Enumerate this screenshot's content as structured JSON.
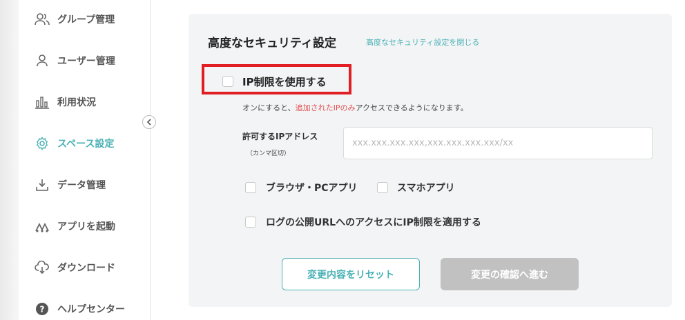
{
  "sidebar": {
    "items": [
      {
        "label": "グループ管理",
        "icon": "group-icon"
      },
      {
        "label": "ユーザー管理",
        "icon": "user-icon"
      },
      {
        "label": "利用状況",
        "icon": "bar-chart-icon"
      },
      {
        "label": "スペース設定",
        "icon": "gear-icon",
        "active": true
      },
      {
        "label": "データ管理",
        "icon": "download-icon"
      },
      {
        "label": "アプリを起動",
        "icon": "apps-icon"
      },
      {
        "label": "ダウンロード",
        "icon": "cloud-download-icon"
      },
      {
        "label": "ヘルプセンター",
        "icon": "help-icon"
      }
    ]
  },
  "panel": {
    "title": "高度なセキュリティ設定",
    "close_link": "高度なセキュリティ設定を閉じる",
    "ip_restriction_label": "IP制限を使用する",
    "description_prefix": "オンにすると、",
    "description_highlight": "追加されたIPのみ",
    "description_suffix": "アクセスできるようになります。",
    "address_label": "許可するIPアドレス",
    "address_sublabel": "（カンマ区切）",
    "address_placeholder": "xxx.xxx.xxx.xxx,xxx.xxx.xxx.xxx/xx",
    "address_value": "",
    "option_browser_pc": "ブラウザ・PCアプリ",
    "option_smartphone": "スマホアプリ",
    "option_log_url": "ログの公開URLへのアクセスにIP制限を適用する",
    "reset_button": "変更内容をリセット",
    "confirm_button": "変更の確認へ進む"
  },
  "colors": {
    "accent": "#4ab1b5",
    "highlight_border": "#e21e25",
    "disabled_button": "#c1c1c1"
  }
}
